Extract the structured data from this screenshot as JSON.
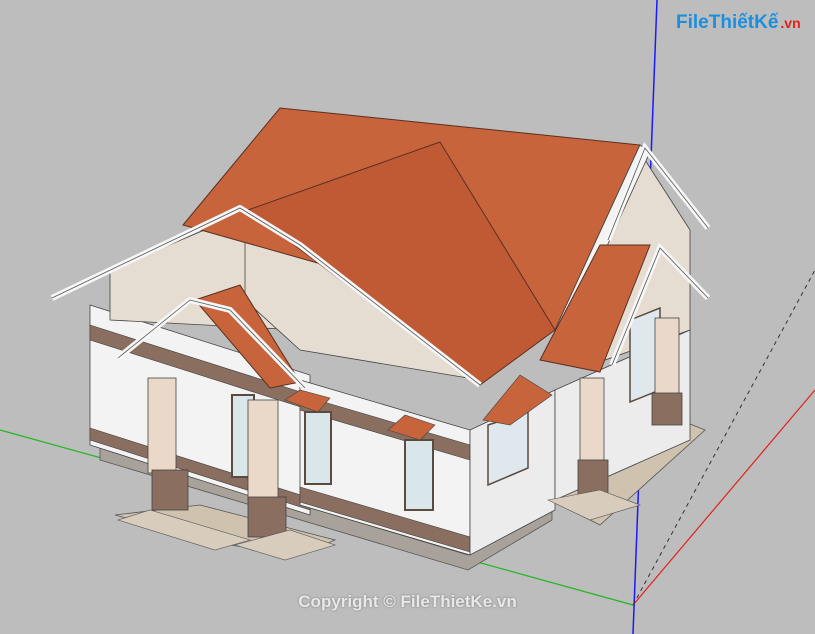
{
  "watermark": {
    "logo_file": "File",
    "logo_brand": "ThiếtKế",
    "logo_tld": ".vn",
    "copyright": "Copyright © FileThietKe.vn"
  },
  "scene": {
    "background": "#bdbdbd",
    "axis_colors": {
      "x": "#e0221a",
      "y": "#1fb81f",
      "z": "#1a1aff"
    },
    "roof_color": "#c8643c",
    "wall_color": "#f3f3f3",
    "trim_color": "#8a6e60"
  }
}
